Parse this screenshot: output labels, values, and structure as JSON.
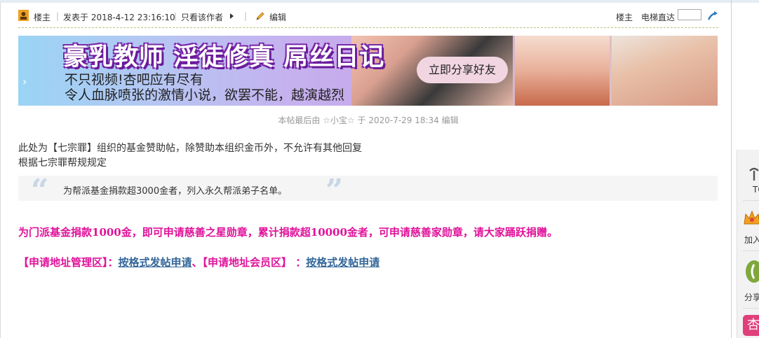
{
  "post_header": {
    "author_label": "楼主",
    "posted_at": "发表于 2018-4-12 23:16:10",
    "only_author": "只看该作者",
    "edit_label": "编辑",
    "floor_label": "楼主",
    "elevator_label": "电梯直达",
    "elevator_value": ""
  },
  "banner": {
    "title": "豪乳教师 淫徒修真 屌丝日记",
    "line1": "不只视频!杏吧应有尽有",
    "line2": "令人血脉喷张的激情小说，欲罢不能，越演越烈",
    "share_button": "立即分享好友"
  },
  "edit_note": "本帖最后由 ☆小宝☆ 于 2020-7-29 18:34 编辑",
  "content": {
    "line1": "此处为【七宗罪】组织的基金赞助帖，除赞助本组织金币外，不允许有其他回复",
    "line2": "根据七宗罪帮规规定",
    "quote": "为帮派基金捐款超3000金者，列入永久帮派弟子名单。",
    "pink_line": "为门派基金捐款1000金，即可申请慈善之星勋章，累计捐款超10000金者，可申请慈善家勋章，请大家踊跃捐赠。",
    "apply_1": "【申请地址管理区】：",
    "link_1": "按格式发帖申请",
    "apply_sep": "、",
    "apply_2": "【申请地址会员区】 ：",
    "link_2": "按格式发帖申请"
  },
  "side_panel": {
    "items": [
      "TO",
      "加入",
      "分享",
      "杏"
    ]
  }
}
